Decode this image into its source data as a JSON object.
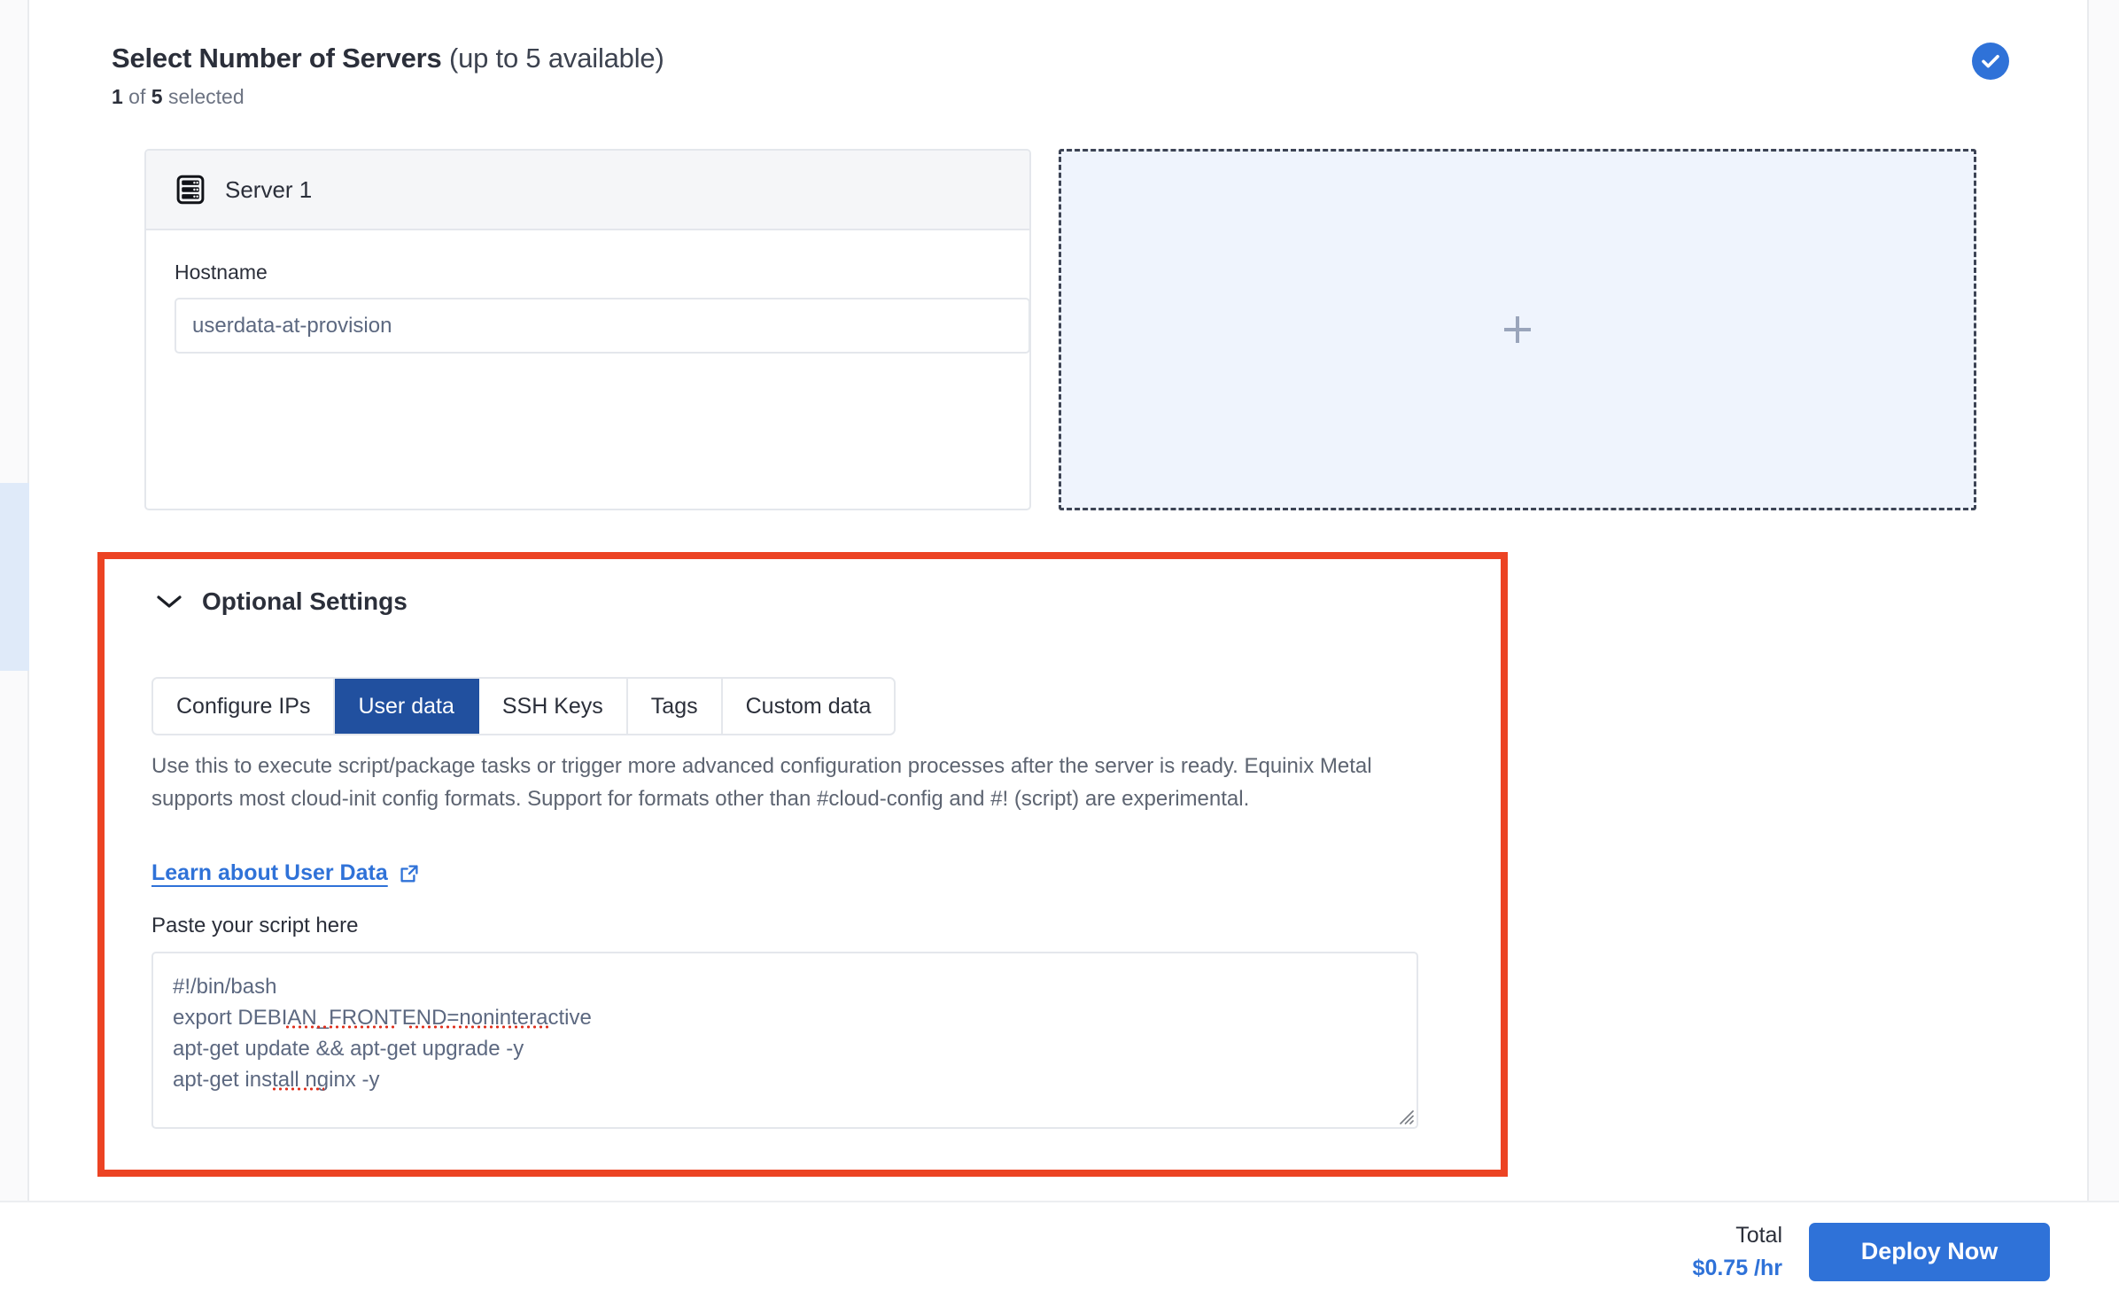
{
  "colors": {
    "accent_blue": "#2f72d8",
    "tab_active_blue": "#21509f",
    "annotation_red": "#ec4323",
    "dropzone_bg": "#eff4fd",
    "text_dark": "#2b2f3a",
    "text_muted": "#5d6471",
    "spellcheck_red": "#e0301e"
  },
  "header": {
    "title_bold": "Select Number of Servers",
    "title_muted": " (up to 5 available)",
    "subtitle_count": "1",
    "subtitle_mid": " of ",
    "subtitle_total": "5",
    "subtitle_end": " selected",
    "status_icon": "check-circle-icon"
  },
  "servers": {
    "card": {
      "icon": "server-rack-icon",
      "title": "Server 1",
      "hostname_label": "Hostname",
      "hostname_value": "userdata-at-provision",
      "hostname_placeholder": "Enter hostname"
    },
    "add_card": {
      "icon": "plus-icon",
      "label": ""
    }
  },
  "optional_settings": {
    "chevron_icon": "chevron-down-icon",
    "title": "Optional Settings",
    "tabs": [
      {
        "label": "Configure IPs",
        "active": false
      },
      {
        "label": "User data",
        "active": true
      },
      {
        "label": "SSH Keys",
        "active": false
      },
      {
        "label": "Tags",
        "active": false
      },
      {
        "label": "Custom data",
        "active": false
      }
    ],
    "description": "Use this to execute script/package tasks or trigger more advanced configuration processes after the server is ready. Equinix Metal supports most cloud-init config formats. Support for formats other than #cloud-config and #! (script) are experimental.",
    "learn_link": {
      "label": "Learn about User Data",
      "icon": "external-link-icon"
    },
    "script": {
      "label": "Paste your script here",
      "value": "#!/bin/bash\nexport DEBIAN_FRONTEND=noninteractive\napt-get update && apt-get upgrade -y\napt-get install nginx -y",
      "placeholder": "Paste your script here",
      "resize_handle": "resize-grip-icon"
    }
  },
  "footer": {
    "total_label": "Total",
    "total_price": "$0.75 /hr",
    "deploy_label": "Deploy Now"
  }
}
